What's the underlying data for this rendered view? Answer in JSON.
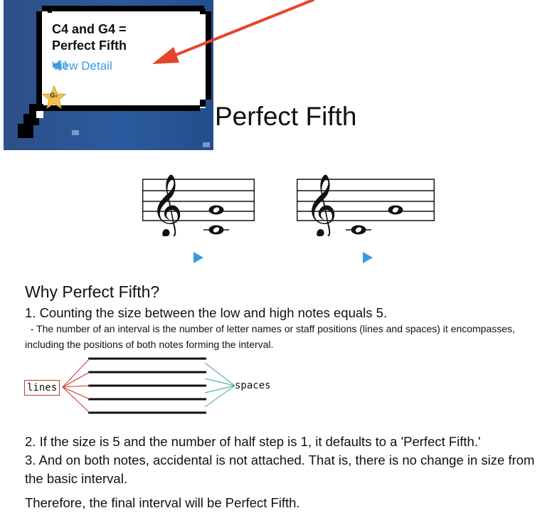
{
  "thumbnail": {
    "bubble_title": "C4 and G4 = Perfect Fifth",
    "view_detail_label": "View Detail",
    "speaker_icon": "speaker-icon",
    "badge_label": "G♭",
    "colors": {
      "panel": "#2b5b9e",
      "link": "#3b9be0",
      "arrow": "#e8432b",
      "star": "#f2c14e"
    }
  },
  "main": {
    "title": "Perfect Fifth",
    "staff_examples": [
      {
        "clef": "treble",
        "notes": [
          "C4",
          "G4"
        ],
        "mode": "harmonic"
      },
      {
        "clef": "treble",
        "notes": [
          "C4",
          "G4"
        ],
        "mode": "melodic"
      }
    ],
    "play_icon": "play-icon",
    "why_heading": "Why Perfect Fifth?",
    "step1": "1. Counting the size between the low and high notes equals 5.",
    "step1_note": "  - The number of an interval is the number of letter names or staff positions (lines and spaces) it encompasses, including the positions of both notes forming the interval.",
    "diagram": {
      "lines_label": "lines",
      "spaces_label": "spaces"
    },
    "step2": "2. If the size is 5 and the number of half step is 1, it defaults to a 'Perfect Fifth.'",
    "step3": "3. And on both notes, accidental is not attached. That is, there is no change in size from the basic interval.",
    "conclusion": "Therefore, the final interval will be Perfect Fifth."
  }
}
